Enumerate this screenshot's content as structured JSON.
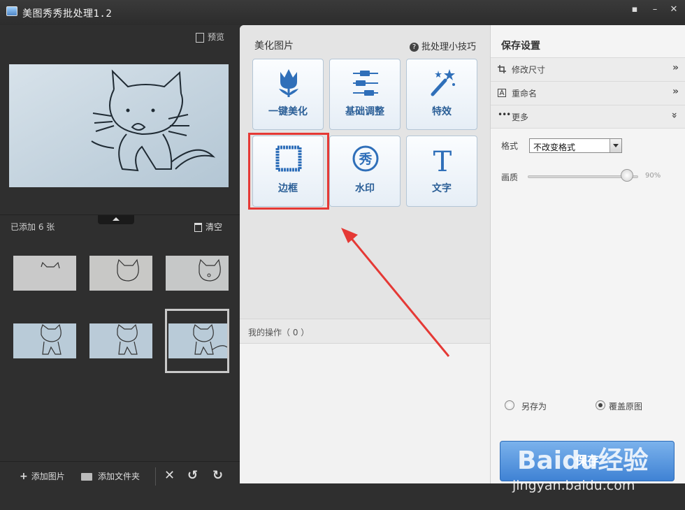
{
  "window": {
    "title": "美图秀秀批处理1.2"
  },
  "left": {
    "preview_label": "预览",
    "added_count": "已添加 6 张",
    "clear_label": "清空",
    "thumbnails": [
      {
        "selected": false
      },
      {
        "selected": false
      },
      {
        "selected": false
      },
      {
        "selected": false
      },
      {
        "selected": false
      },
      {
        "selected": true
      }
    ],
    "add_image_label": "添加图片",
    "add_folder_label": "添加文件夹"
  },
  "middle": {
    "section_title": "美化图片",
    "tips_label": "批处理小技巧",
    "tiles": [
      {
        "label": "一键美化",
        "icon": "tulip-icon"
      },
      {
        "label": "基础调整",
        "icon": "sliders-icon"
      },
      {
        "label": "特效",
        "icon": "magic-wand-icon"
      },
      {
        "label": "边框",
        "icon": "frame-icon",
        "highlighted": true
      },
      {
        "label": "水印",
        "icon": "watermark-stamp-icon"
      },
      {
        "label": "文字",
        "icon": "text-t-icon"
      }
    ],
    "operations_label": "我的操作（ 0 ）"
  },
  "right": {
    "title": "保存设置",
    "accordion": [
      {
        "label": "修改尺寸",
        "icon": "crop-icon",
        "chevron": "»"
      },
      {
        "label": "重命名",
        "icon": "rename-icon",
        "chevron": "»"
      },
      {
        "label": "更多",
        "icon": "more-dots-icon",
        "chevron": "»"
      }
    ],
    "format_label": "格式",
    "format_value": "不改变格式",
    "quality_label": "画质",
    "quality_value": "90%",
    "quality_fraction": 0.9,
    "save_as_label": "另存为",
    "overwrite_label": "覆盖原图",
    "overwrite_selected": true,
    "save_button": "保存"
  },
  "watermark": {
    "brand": "Baidu经验",
    "url": "jingyan.baidu.com"
  },
  "colors": {
    "accent_blue": "#3f82d4",
    "tile_text": "#2b5f97",
    "highlight_red": "#e53935"
  }
}
